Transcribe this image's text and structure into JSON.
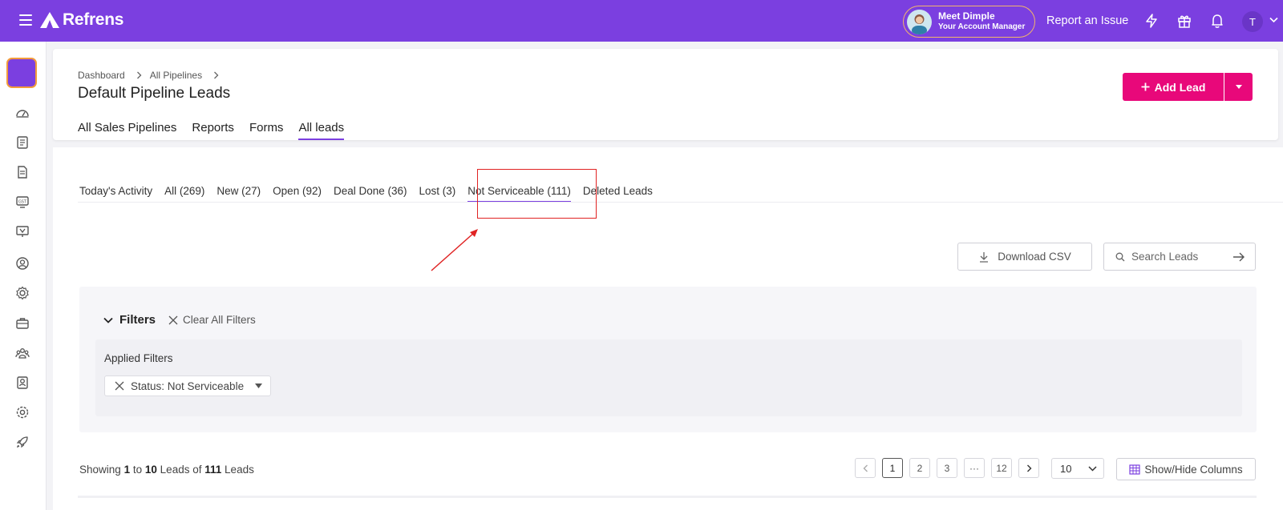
{
  "topbar": {
    "brand": "Refrens",
    "meet_title": "Meet Dimple",
    "meet_subtitle": "Your Account Manager",
    "report_issue": "Report an Issue",
    "user_initial": "T",
    "icons": [
      "menu-icon",
      "lightning-icon",
      "gift-icon",
      "bell-icon",
      "chevron-down-icon"
    ]
  },
  "sidebar": {
    "icons": [
      "dashboard-icon",
      "invoice-icon",
      "document-icon",
      "gst-icon",
      "presentation-icon",
      "user-icon",
      "settings-users-icon",
      "briefcase-icon",
      "team-icon",
      "badge-icon",
      "gear-icon",
      "rocket-icon"
    ]
  },
  "header": {
    "breadcrumb": [
      "Dashboard",
      "All Pipelines"
    ],
    "title": "Default Pipeline Leads",
    "tabs": [
      "All Sales Pipelines",
      "Reports",
      "Forms",
      "All leads"
    ],
    "active_tab": "All leads",
    "add_lead_label": "Add Lead"
  },
  "status_tabs": {
    "items": [
      "Today's Activity",
      "All (269)",
      "New (27)",
      "Open (92)",
      "Deal Done (36)",
      "Lost (3)",
      "Not Serviceable (111)",
      "Deleted Leads"
    ],
    "active": "Not Serviceable (111)"
  },
  "actions": {
    "download_csv": "Download CSV",
    "search_placeholder": "Search Leads"
  },
  "filters": {
    "title": "Filters",
    "clear_all": "Clear All Filters",
    "applied_label": "Applied Filters",
    "chip": "Status: Not Serviceable"
  },
  "footer": {
    "showing_prefix": "Showing",
    "from": "1",
    "to_word": "to",
    "to": "10",
    "leads_of": "Leads of",
    "total": "111",
    "leads_word": "Leads",
    "pages": [
      "1",
      "2",
      "3",
      "···",
      "12"
    ],
    "current_page": "1",
    "per_page": "10",
    "show_hide": "Show/Hide Columns"
  },
  "colors": {
    "brand": "#7b3fe0",
    "accent": "#e8087a",
    "highlight": "#e02323"
  }
}
